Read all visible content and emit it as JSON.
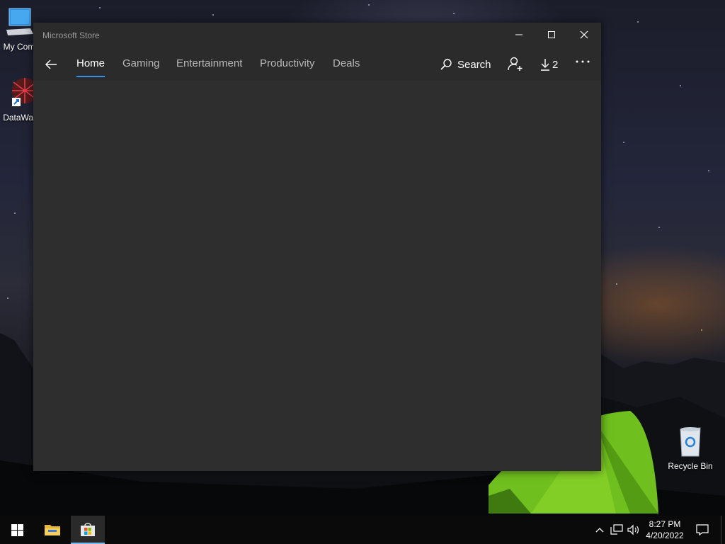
{
  "desktop": {
    "icons": [
      {
        "label": "My Com",
        "icon": "computer-icon"
      },
      {
        "label": "DataWag",
        "icon": "datawag-app-icon"
      },
      {
        "label": "Recycle Bin",
        "icon": "recycle-bin-icon"
      }
    ]
  },
  "window": {
    "title": "Microsoft Store",
    "controls": {
      "minimize": "minimize-icon",
      "maximize": "maximize-icon",
      "close": "close-icon"
    }
  },
  "nav": {
    "back_icon": "back-arrow-icon",
    "tabs": [
      {
        "label": "Home",
        "active": true
      },
      {
        "label": "Gaming",
        "active": false
      },
      {
        "label": "Entertainment",
        "active": false
      },
      {
        "label": "Productivity",
        "active": false
      },
      {
        "label": "Deals",
        "active": false
      }
    ],
    "search_label": "Search",
    "downloads_count": "2",
    "accent_color": "#3a8ee6"
  },
  "taskbar": {
    "pinned": [
      {
        "name": "start",
        "icon": "windows-logo-icon"
      },
      {
        "name": "file-explorer",
        "icon": "folder-icon"
      },
      {
        "name": "microsoft-store",
        "icon": "store-bag-icon",
        "active": true
      }
    ],
    "tray": {
      "time": "8:27 PM",
      "date": "4/20/2022"
    }
  }
}
